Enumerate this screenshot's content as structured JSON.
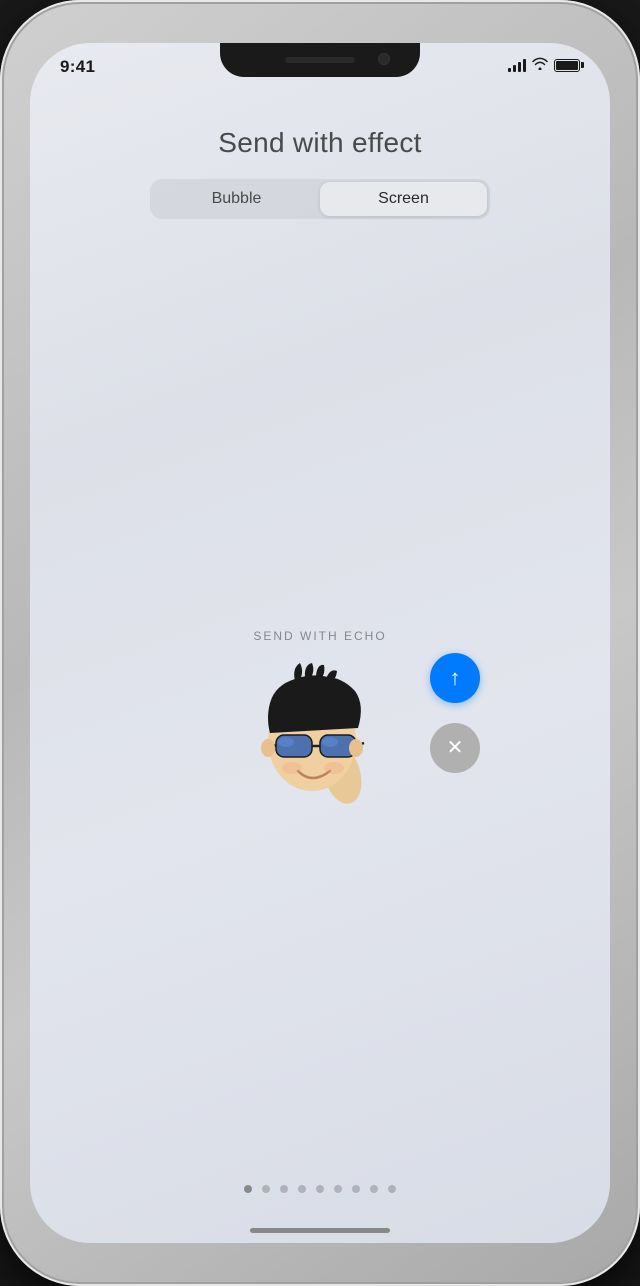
{
  "status_bar": {
    "time": "9:41",
    "signal_bars": [
      4,
      7,
      10,
      13
    ],
    "battery_percent": 100
  },
  "header": {
    "title": "Send with effect"
  },
  "tabs": [
    {
      "label": "Bubble",
      "active": false
    },
    {
      "label": "Screen",
      "active": true
    }
  ],
  "effect": {
    "name": "SEND WITH ECHO"
  },
  "buttons": {
    "send_label": "↑",
    "cancel_label": "✕"
  },
  "page_dots": {
    "total": 9,
    "active_index": 0
  },
  "colors": {
    "send_blue": "#007aff",
    "cancel_gray": "#b0b0b0",
    "active_tab_bg": "#e8e9ec"
  }
}
